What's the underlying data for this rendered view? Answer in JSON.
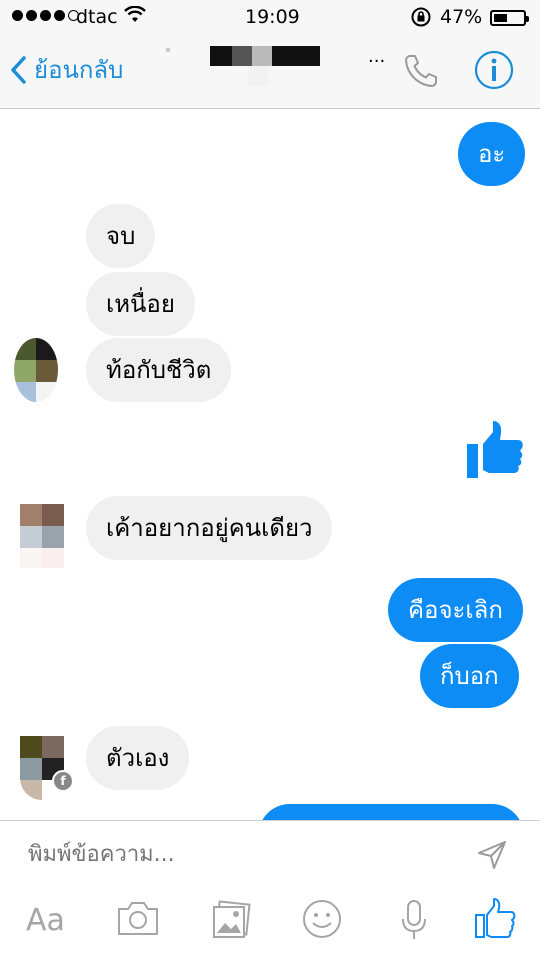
{
  "status": {
    "carrier": "dtac",
    "time": "19:09",
    "battery_percent": "47%",
    "battery_level": 0.47
  },
  "nav": {
    "back_label": "ย้อนกลับ",
    "title_ellipsis": "..."
  },
  "messages": [
    {
      "side": "out",
      "text": "อะ"
    },
    {
      "side": "in",
      "text": "จบ"
    },
    {
      "side": "in",
      "text": "เหนื่อย"
    },
    {
      "side": "in",
      "text": "ท้อกับชีวิต"
    },
    {
      "side": "out",
      "type": "like",
      "icon": "thumbs-up-icon"
    },
    {
      "side": "in",
      "text": "เค้าอยากอยู่คนเดียว"
    },
    {
      "side": "out",
      "text": "คือจะเลิก"
    },
    {
      "side": "out",
      "text": "ก็บอก"
    },
    {
      "side": "in",
      "text": "ตัวเอง"
    }
  ],
  "composer": {
    "placeholder": "พิมพ์ข้อความ...",
    "toolbar": {
      "text_label": "Aa",
      "icons": [
        "camera-icon",
        "gallery-icon",
        "emoji-icon",
        "microphone-icon",
        "thumbs-up-icon"
      ]
    }
  },
  "colors": {
    "accent": "#1a8cd8",
    "bubble_out": "#0d8cf5",
    "bubble_in": "#f0f0f0",
    "placeholder": "#b8b8b8"
  }
}
